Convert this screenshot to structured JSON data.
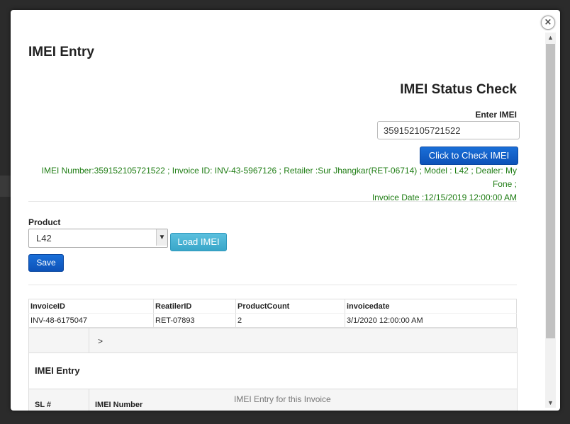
{
  "modal": {
    "title": "IMEI Entry",
    "close_glyph": "×"
  },
  "status_check": {
    "title": "IMEI Status Check",
    "input_label": "Enter IMEI",
    "input_value": "359152105721522",
    "button_label": "Click to Check IMEI",
    "result_line1": "IMEI Number:359152105721522 ; Invoice ID: INV-43-5967126 ; Retailer :Sur Jhangkar(RET-06714) ; Model : L42 ; Dealer: My Fone ;",
    "result_line2": "Invoice Date :12/15/2019 12:00:00 AM",
    "result_color": "#1f7d14"
  },
  "product": {
    "label": "Product",
    "selected": "L42",
    "load_button": "Load IMEI",
    "save_button": "Save"
  },
  "invoice_table": {
    "headers": [
      "InvoiceID",
      "ReatilerID",
      "ProductCount",
      "invoicedate"
    ],
    "rows": [
      [
        "INV-48-6175047",
        "RET-07893",
        "2",
        "3/1/2020 12:00:00 AM"
      ]
    ]
  },
  "imei_entry": {
    "nav_arrow": ">",
    "title": "IMEI Entry",
    "col_sl": "SL #",
    "col_imei": "IMEI Number",
    "note": "IMEI Entry for this Invoice"
  },
  "scrollbar": {
    "up_glyph": "▲",
    "down_glyph": "▼"
  },
  "colors": {
    "primary_button": "#0d52b8",
    "info_button": "#39a6c9",
    "success_text": "#1f7d14"
  }
}
